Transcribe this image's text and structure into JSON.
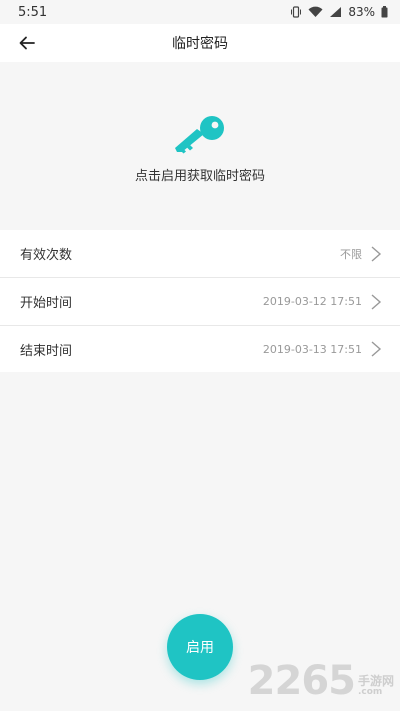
{
  "status_bar": {
    "time": "5:51",
    "battery": "83%"
  },
  "header": {
    "title": "临时密码"
  },
  "hero": {
    "icon": "key-icon",
    "hint": "点击启用获取临时密码",
    "accent_color": "#1fc4c4"
  },
  "settings": [
    {
      "label": "有效次数",
      "value": "不限"
    },
    {
      "label": "开始时间",
      "value": "2019-03-12 17:51"
    },
    {
      "label": "结束时间",
      "value": "2019-03-13 17:51"
    }
  ],
  "actions": {
    "enable_label": "启用"
  },
  "watermark": {
    "number": "2265",
    "name": "手游网",
    "domain": ".com"
  }
}
